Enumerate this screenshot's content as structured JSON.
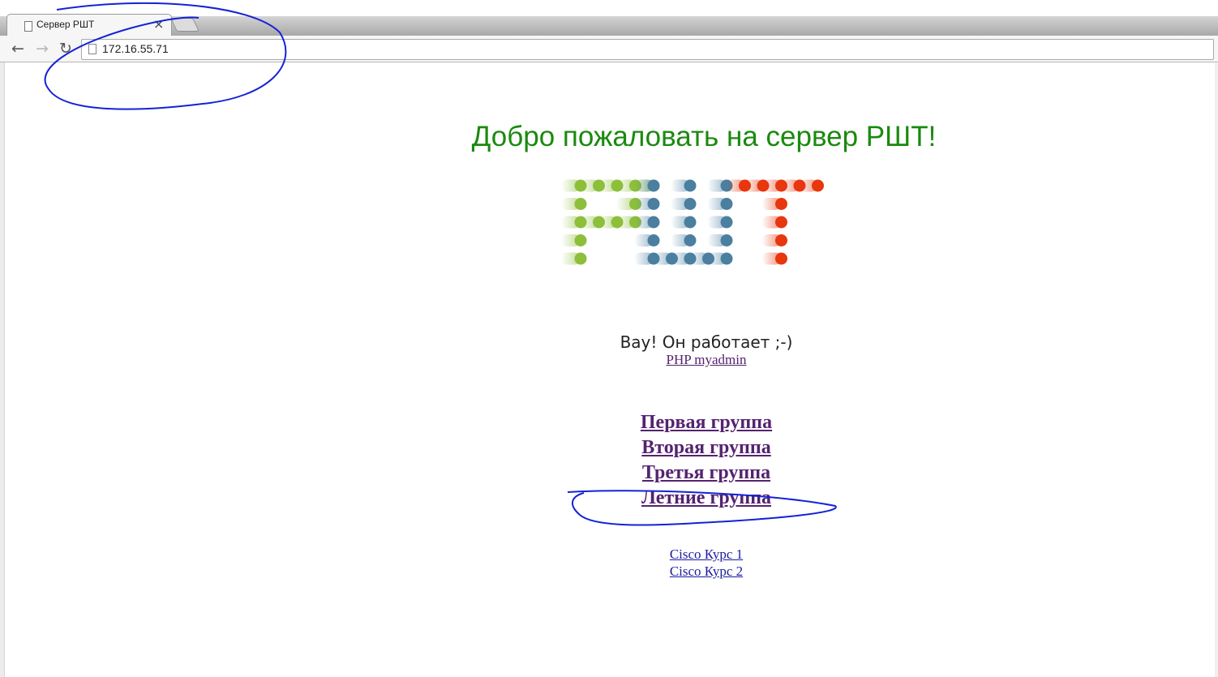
{
  "browser": {
    "tab_title": "Сервер РШТ",
    "tab_close": "×",
    "url": "172.16.55.71",
    "back": "←",
    "forward": "→",
    "reload": "↻"
  },
  "page": {
    "heading": "Добро пожаловать на сервер РШТ!",
    "heading_color": "#1a8a0e",
    "logo": {
      "letters": "РШТ",
      "colors": {
        "Р": "#8dbf3a",
        "Ш": "#4a7fa0",
        "Т": "#e8360e"
      }
    },
    "status_text": "Вау! Он работает ;-)",
    "phpmyadmin_link": "PHP myadmin",
    "group_links": [
      "Первая группа",
      "Вторая группа",
      "Третья группа",
      "Летние группа"
    ],
    "cisco_links": [
      "Cisco Курс 1",
      "Cisco Курс 2"
    ]
  }
}
